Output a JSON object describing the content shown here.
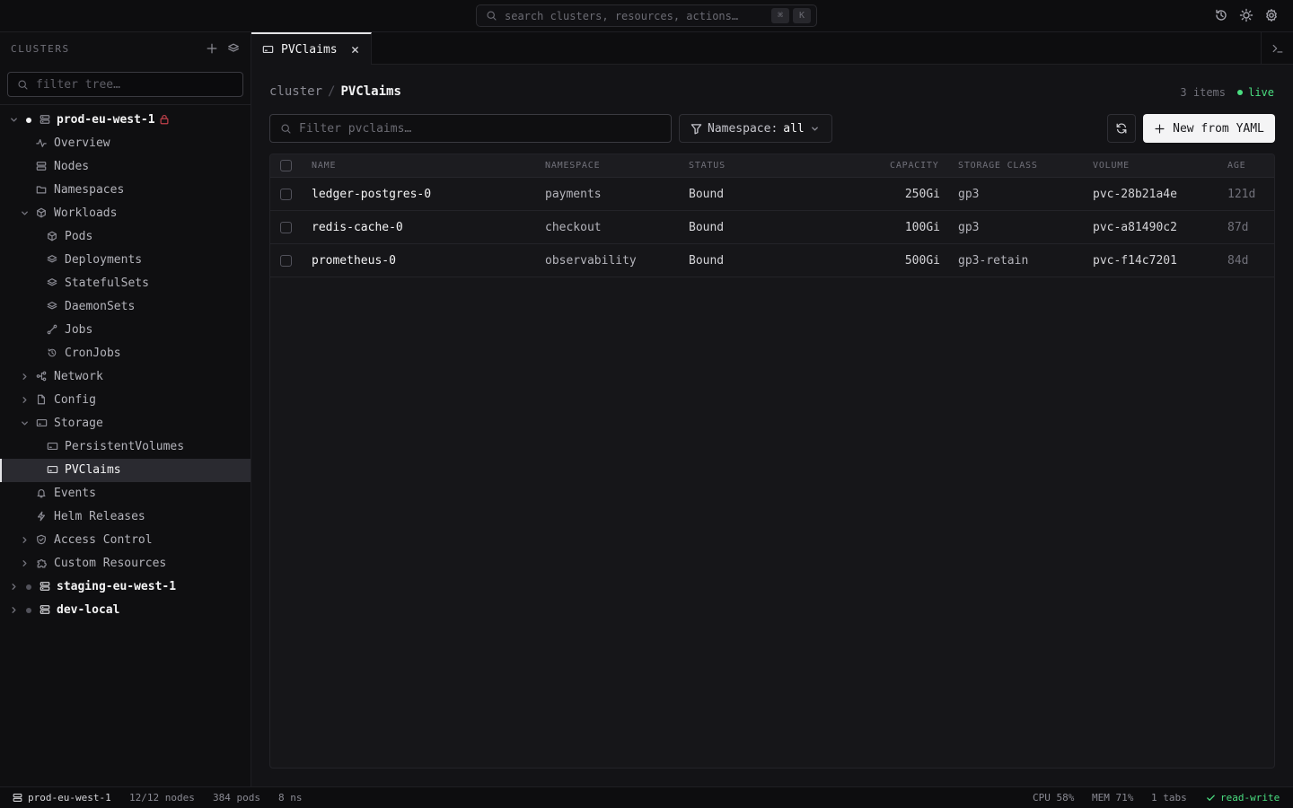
{
  "search": {
    "placeholder": "search clusters, resources, actions…",
    "kbd_modifier": "⌘",
    "kbd_key": "K"
  },
  "sidebar": {
    "title": "CLUSTERS",
    "filter_placeholder": "filter tree…",
    "clusters": [
      {
        "label": "prod-eu-west-1",
        "expanded": true,
        "locked": true
      },
      {
        "label": "staging-eu-west-1",
        "expanded": false
      },
      {
        "label": "dev-local",
        "expanded": false
      }
    ],
    "items": {
      "overview": "Overview",
      "nodes": "Nodes",
      "namespaces": "Namespaces",
      "workloads": "Workloads",
      "pods": "Pods",
      "deployments": "Deployments",
      "statefulsets": "StatefulSets",
      "daemonsets": "DaemonSets",
      "jobs": "Jobs",
      "cronjobs": "CronJobs",
      "network": "Network",
      "config": "Config",
      "storage": "Storage",
      "persistentvolumes": "PersistentVolumes",
      "pvclaims": "PVClaims",
      "events": "Events",
      "helm": "Helm Releases",
      "access": "Access Control",
      "custom": "Custom Resources"
    }
  },
  "tabs": [
    {
      "label": "PVClaims",
      "active": true
    }
  ],
  "main": {
    "breadcrumb": {
      "root": "cluster",
      "separator": "/",
      "current": "PVClaims"
    },
    "items_count": "3 items",
    "live_label": "live",
    "filter_placeholder": "Filter pvclaims…",
    "namespace_label": "Namespace:",
    "namespace_value": "all",
    "new_button_label": "New from YAML"
  },
  "table": {
    "columns": [
      "NAME",
      "NAMESPACE",
      "STATUS",
      "CAPACITY",
      "STORAGE CLASS",
      "VOLUME",
      "AGE"
    ],
    "rows": [
      {
        "name": "ledger-postgres-0",
        "namespace": "payments",
        "status": "Bound",
        "capacity": "250Gi",
        "storage_class": "gp3",
        "volume": "pvc-28b21a4e",
        "age": "121d"
      },
      {
        "name": "redis-cache-0",
        "namespace": "checkout",
        "status": "Bound",
        "capacity": "100Gi",
        "storage_class": "gp3",
        "volume": "pvc-a81490c2",
        "age": "87d"
      },
      {
        "name": "prometheus-0",
        "namespace": "observability",
        "status": "Bound",
        "capacity": "500Gi",
        "storage_class": "gp3-retain",
        "volume": "pvc-f14c7201",
        "age": "84d"
      }
    ]
  },
  "statusbar": {
    "cluster": "prod-eu-west-1",
    "nodes": "12/12 nodes",
    "pods": "384 pods",
    "namespaces": "8 ns",
    "cpu": "CPU 58%",
    "mem": "MEM 71%",
    "tabs": "1 tabs",
    "mode": "read-write"
  },
  "colors": {
    "background": "#131316",
    "sidebar": "#0f0f11",
    "accent_live": "#4ade80",
    "lock": "#c2414b",
    "primary_button": "#f4f4f5"
  }
}
